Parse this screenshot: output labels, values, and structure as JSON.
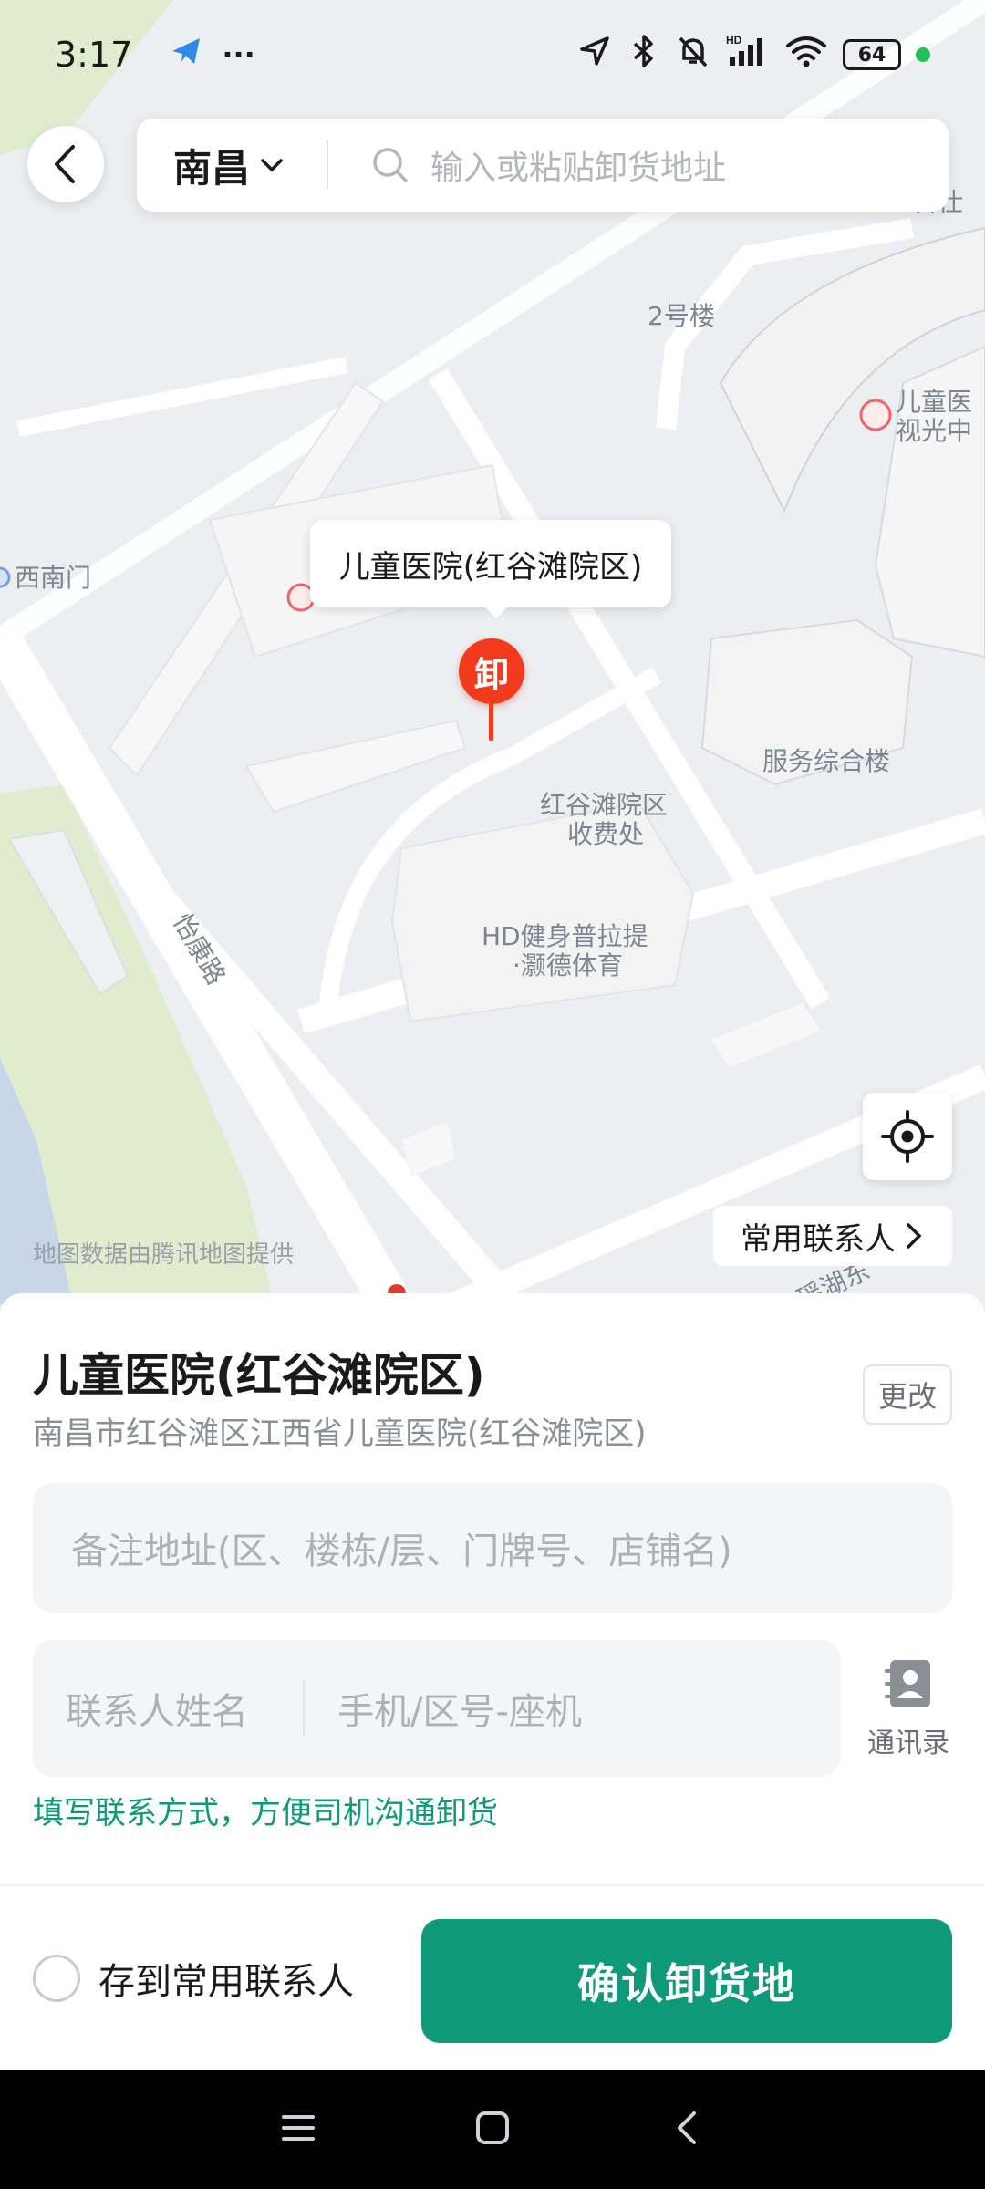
{
  "status_bar": {
    "time": "3:17",
    "battery": "64",
    "more": "···",
    "hd": "HD"
  },
  "top_bar": {
    "city": "南昌",
    "search_placeholder": "输入或粘贴卸货地址"
  },
  "map": {
    "labels": {
      "building_2": "2号楼",
      "keji": "科仕",
      "childrens_eye_1": "儿童医",
      "childrens_eye_2": "视光中",
      "southwest_gate": "西南门",
      "service_building": "服务综合楼",
      "toll_1": "红谷滩院区",
      "toll_2": "收费处",
      "gym_1": "HD健身普拉提",
      "gym_2": "·灏德体育",
      "yikang_road": "怡康路",
      "lake": "瑶湖东"
    },
    "credit": "地图数据由腾讯地图提供",
    "marker_tooltip": "儿童医院(红谷滩院区)",
    "marker_badge": "卸",
    "contacts_chip": "常用联系人"
  },
  "sheet": {
    "title": "儿童医院(红谷滩院区)",
    "subtitle": "南昌市红谷滩区江西省儿童医院(红谷滩院区)",
    "change_label": "更改",
    "note_placeholder": "备注地址(区、楼栋/层、门牌号、店铺名)",
    "contact_name_placeholder": "联系人姓名",
    "contact_phone_placeholder": "手机/区号-座机",
    "address_book_label": "通讯录",
    "hint": "填写联系方式，方便司机沟通卸货",
    "save_label": "存到常用联系人",
    "confirm_label": "确认卸货地"
  },
  "colors": {
    "accent": "#0e9a78",
    "marker": "#f23b1c",
    "hint_text": "#0e9a78"
  }
}
